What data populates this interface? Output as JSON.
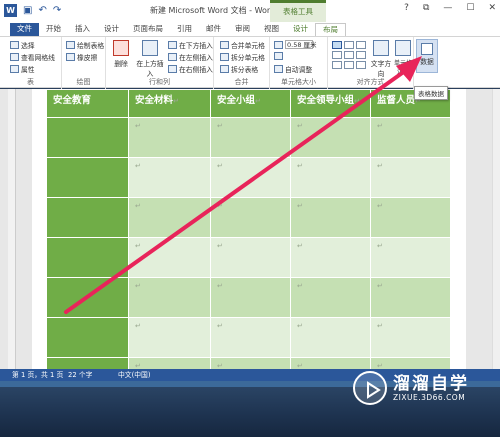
{
  "window": {
    "title": "新建 Microsoft Word 文档 - Word",
    "context_tab_group": "表格工具",
    "controls": [
      "?",
      "⧉",
      "—",
      "☐",
      "✕"
    ]
  },
  "tabs": [
    {
      "label": "文件",
      "type": "file"
    },
    {
      "label": "开始",
      "type": "normal"
    },
    {
      "label": "插入",
      "type": "normal"
    },
    {
      "label": "设计",
      "type": "normal"
    },
    {
      "label": "页面布局",
      "type": "normal"
    },
    {
      "label": "引用",
      "type": "normal"
    },
    {
      "label": "邮件",
      "type": "normal"
    },
    {
      "label": "审阅",
      "type": "normal"
    },
    {
      "label": "视图",
      "type": "normal"
    },
    {
      "label": "设计",
      "type": "ctx"
    },
    {
      "label": "布局",
      "type": "active"
    }
  ],
  "ribbon": {
    "table_group": {
      "label": "表",
      "items": [
        "选择",
        "查看网格线",
        "属性"
      ]
    },
    "draw_group": {
      "label": "绘图",
      "items": [
        "绘制表格",
        "橡皮擦"
      ]
    },
    "rowcol_group": {
      "label": "行和列",
      "delete": "删除",
      "insert_above": "在上方插入",
      "items": [
        "在下方插入",
        "在左侧插入",
        "在右侧插入"
      ]
    },
    "merge_group": {
      "label": "合并",
      "items": [
        "合并单元格",
        "拆分单元格",
        "拆分表格"
      ]
    },
    "cellsize_group": {
      "label": "单元格大小",
      "height_value": "0.58 厘米",
      "autofit": "自动调整"
    },
    "align_group": {
      "label": "对齐方式",
      "text_direction": "文字方向",
      "cell_margins": "单元格边距"
    },
    "data_group": {
      "label": "数据"
    },
    "tooltip": "表格数据"
  },
  "table": {
    "headers": [
      "安全教育",
      "安全材料",
      "安全小组",
      "安全领导小组",
      "监督人员"
    ],
    "row_count": 7,
    "cell_mark": "↵"
  },
  "status": {
    "page": "第 1 页，共 1 页",
    "words": "22 个字",
    "language": "中文(中国)"
  },
  "watermark": {
    "title": "溜溜自学",
    "url": "ZIXUE.3D66.COM"
  },
  "colors": {
    "word_blue": "#2b579a",
    "table_header_green": "#70ad47",
    "table_band_dark": "#c5e0b3",
    "table_band_light": "#e2efda",
    "arrow": "#e8245a"
  }
}
